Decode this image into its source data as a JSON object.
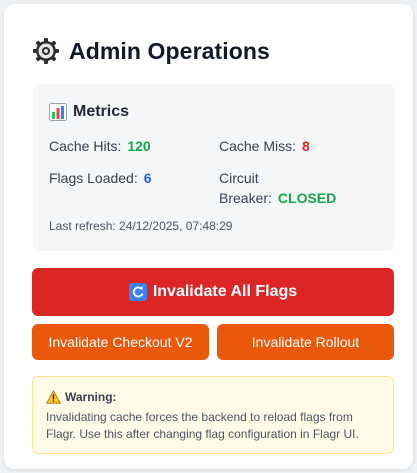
{
  "title": "Admin Operations",
  "title_icon": "gear-icon",
  "metrics": {
    "heading": "Metrics",
    "heading_icon": "bar-chart-icon",
    "cache_hits_label": "Cache Hits:",
    "cache_hits_value": "120",
    "cache_miss_label": "Cache Miss:",
    "cache_miss_value": "8",
    "flags_loaded_label": "Flags Loaded:",
    "flags_loaded_value": "6",
    "circuit_label_1": "Circuit",
    "circuit_label_2": "Breaker:",
    "circuit_value": "CLOSED",
    "last_refresh": "Last refresh: 24/12/2025, 07:48:29"
  },
  "buttons": {
    "invalidate_all": "Invalidate All Flags",
    "invalidate_all_icon": "refresh-icon",
    "invalidate_checkout": "Invalidate Checkout V2",
    "invalidate_rollout": "Invalidate Rollout"
  },
  "warning": {
    "title": "Warning:",
    "icon": "warning-icon",
    "text": "Invalidating cache forces the backend to reload flags from Flagr. Use this after changing flag configuration in Flagr UI."
  },
  "colors": {
    "danger": "#dc2626",
    "orange": "#ea580c",
    "success": "#16a34a",
    "info": "#2563eb",
    "warning_bg": "#fefce8"
  }
}
